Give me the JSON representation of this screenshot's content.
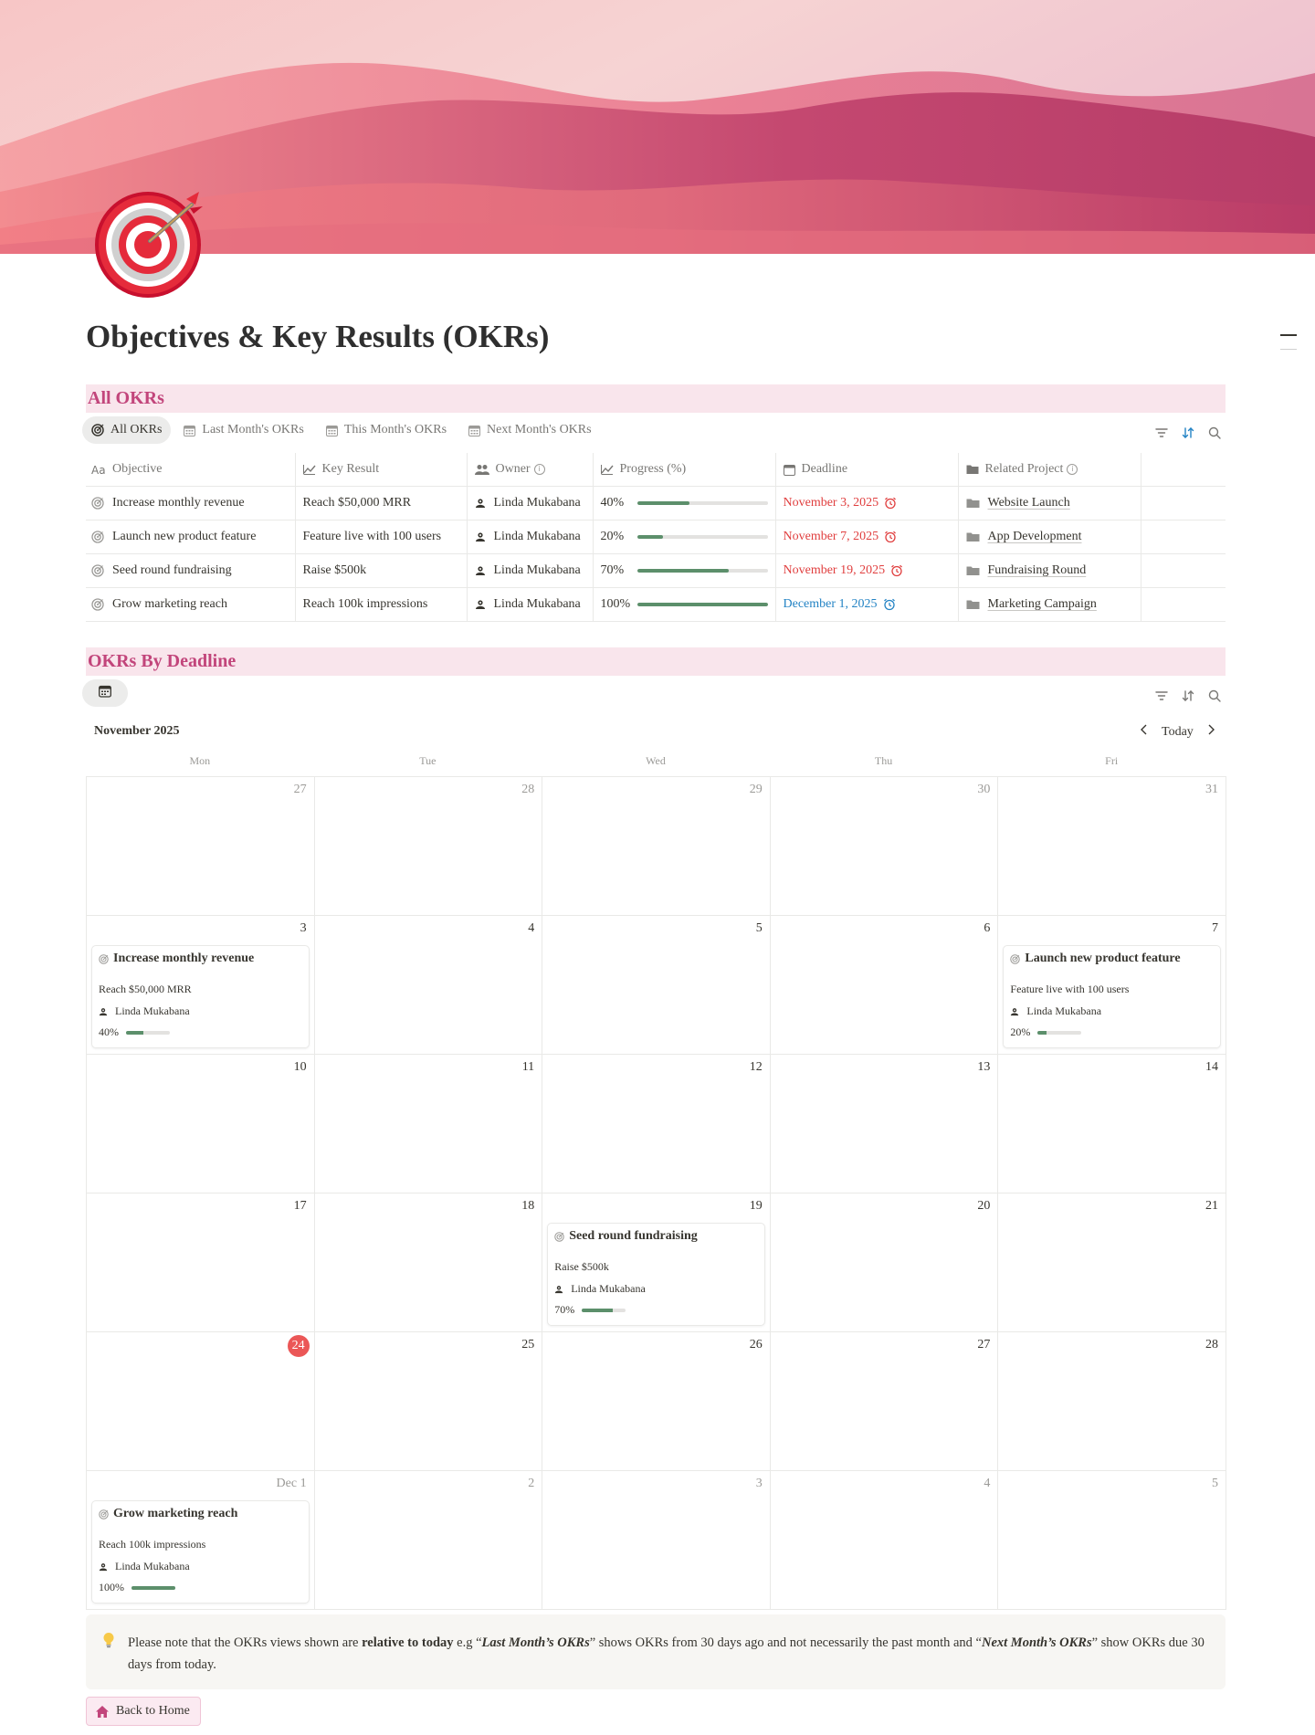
{
  "page": {
    "title": "Objectives & Key Results (OKRs)",
    "icon": "target-dart-icon",
    "cover": "pink-dunes-cover"
  },
  "all_okrs": {
    "header": "All OKRs",
    "tabs": [
      {
        "label": "All OKRs",
        "icon": "target-icon",
        "active": true
      },
      {
        "label": "Last Month's OKRs",
        "icon": "calendar-icon",
        "active": false
      },
      {
        "label": "This Month's OKRs",
        "icon": "calendar-icon",
        "active": false
      },
      {
        "label": "Next Month's OKRs",
        "icon": "calendar-icon",
        "active": false
      }
    ],
    "toolbar": [
      "filter-icon",
      "sort-icon",
      "search-icon"
    ],
    "columns": [
      {
        "label": "Objective",
        "icon": "text-aa-icon"
      },
      {
        "label": "Key Result",
        "icon": "trend-icon"
      },
      {
        "label": "Owner",
        "icon": "people-icon",
        "info": true
      },
      {
        "label": "Progress (%)",
        "icon": "trend-icon"
      },
      {
        "label": "Deadline",
        "icon": "calendar-icon"
      },
      {
        "label": "Related Project",
        "icon": "folder-icon",
        "info": true
      }
    ],
    "rows": [
      {
        "objective": "Increase monthly revenue",
        "key_result": "Reach $50,000 MRR",
        "owner": "Linda Mukabana",
        "progress_label": "40%",
        "progress": 0.4,
        "deadline": "November 3, 2025",
        "deadline_status": "overdue",
        "project": "Website Launch"
      },
      {
        "objective": "Launch new product feature",
        "key_result": "Feature live with 100 users",
        "owner": "Linda Mukabana",
        "progress_label": "20%",
        "progress": 0.2,
        "deadline": "November 7, 2025",
        "deadline_status": "overdue",
        "project": "App Development"
      },
      {
        "objective": "Seed round fundraising",
        "key_result": "Raise $500k",
        "owner": "Linda Mukabana",
        "progress_label": "70%",
        "progress": 0.7,
        "deadline": "November 19, 2025",
        "deadline_status": "overdue",
        "project": "Fundraising Round"
      },
      {
        "objective": "Grow marketing reach",
        "key_result": "Reach 100k impressions",
        "owner": "Linda Mukabana",
        "progress_label": "100%",
        "progress": 1.0,
        "deadline": "December 1, 2025",
        "deadline_status": "upcoming",
        "project": "Marketing Campaign"
      }
    ]
  },
  "by_deadline": {
    "header": "OKRs By Deadline",
    "month": "November 2025",
    "today_label": "Today",
    "weekdays": [
      "Mon",
      "Tue",
      "Wed",
      "Thu",
      "Fri"
    ],
    "weeks": [
      [
        {
          "d": "27",
          "muted": true
        },
        {
          "d": "28",
          "muted": true
        },
        {
          "d": "29",
          "muted": true
        },
        {
          "d": "30",
          "muted": true
        },
        {
          "d": "31",
          "muted": true
        }
      ],
      [
        {
          "d": "3",
          "okr": 0
        },
        {
          "d": "4"
        },
        {
          "d": "5"
        },
        {
          "d": "6"
        },
        {
          "d": "7",
          "okr": 1
        }
      ],
      [
        {
          "d": "10"
        },
        {
          "d": "11"
        },
        {
          "d": "12"
        },
        {
          "d": "13"
        },
        {
          "d": "14"
        }
      ],
      [
        {
          "d": "17"
        },
        {
          "d": "18"
        },
        {
          "d": "19",
          "okr": 2
        },
        {
          "d": "20"
        },
        {
          "d": "21"
        }
      ],
      [
        {
          "d": "24",
          "today": true
        },
        {
          "d": "25"
        },
        {
          "d": "26"
        },
        {
          "d": "27"
        },
        {
          "d": "28"
        }
      ],
      [
        {
          "d": "Dec 1",
          "muted": true,
          "okr": 3
        },
        {
          "d": "2",
          "muted": true
        },
        {
          "d": "3",
          "muted": true
        },
        {
          "d": "4",
          "muted": true
        },
        {
          "d": "5",
          "muted": true
        }
      ]
    ]
  },
  "callout": {
    "icon": "lightbulb-icon",
    "p1": "Please note that the OKRs views shown are ",
    "b1": "relative to today",
    "p2": " e.g “",
    "bi1": "Last Month’s OKRs",
    "p3": "” shows OKRs from 30 days ago and not necessarily the past month and “",
    "bi2": "Next Month’s OKRs",
    "p4": "” show OKRs due 30 days from today."
  },
  "back_button": {
    "label": "Back to Home",
    "icon": "home-icon"
  },
  "colors": {
    "accent_pink": "#c2457b",
    "header_bg": "#f9e5ec",
    "overdue": "#e03e3e",
    "upcoming": "#2383c4",
    "progress": "#5c8f6b"
  }
}
